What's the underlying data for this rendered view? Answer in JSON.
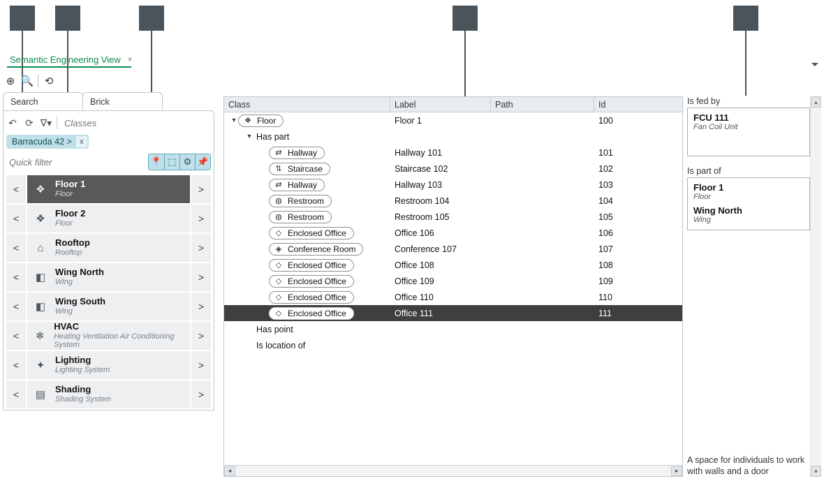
{
  "tab": {
    "title": "Semantic Engineering View"
  },
  "left_tabs": {
    "search": "Search",
    "brick": "Brick"
  },
  "classes_placeholder": "Classes",
  "chip": "Barracuda 42 >",
  "quick_filter_placeholder": "Quick filter",
  "nav": [
    {
      "title": "Floor 1",
      "sub": "Floor",
      "icon": "floor-icon",
      "sel": true
    },
    {
      "title": "Floor 2",
      "sub": "Floor",
      "icon": "floor-icon"
    },
    {
      "title": "Rooftop",
      "sub": "Rooftop",
      "icon": "rooftop-icon"
    },
    {
      "title": "Wing North",
      "sub": "Wing",
      "icon": "wing-icon"
    },
    {
      "title": "Wing South",
      "sub": "Wing",
      "icon": "wing-icon"
    },
    {
      "title": "HVAC",
      "sub": "Heating Ventilation Air Conditioning System",
      "icon": "hvac-icon"
    },
    {
      "title": "Lighting",
      "sub": "Lighting System",
      "icon": "lighting-icon"
    },
    {
      "title": "Shading",
      "sub": "Shading System",
      "icon": "shading-icon"
    }
  ],
  "columns": {
    "class": "Class",
    "label": "Label",
    "path": "Path",
    "id": "Id"
  },
  "rows": [
    {
      "indent": 0,
      "expander": "▾",
      "pill": true,
      "picon": "floor-icon",
      "pclass": "Floor",
      "label": "Floor 1",
      "id": "100"
    },
    {
      "indent": 1,
      "expander": "▾",
      "pill": false,
      "pclass": "Has part"
    },
    {
      "indent": 2,
      "pill": true,
      "picon": "hallway-icon",
      "pclass": "Hallway",
      "label": "Hallway 101",
      "id": "101"
    },
    {
      "indent": 2,
      "pill": true,
      "picon": "staircase-icon",
      "pclass": "Staircase",
      "label": "Staircase 102",
      "id": "102"
    },
    {
      "indent": 2,
      "pill": true,
      "picon": "hallway-icon",
      "pclass": "Hallway",
      "label": "Hallway 103",
      "id": "103"
    },
    {
      "indent": 2,
      "pill": true,
      "picon": "restroom-icon",
      "pclass": "Restroom",
      "label": "Restroom 104",
      "id": "104"
    },
    {
      "indent": 2,
      "pill": true,
      "picon": "restroom-icon",
      "pclass": "Restroom",
      "label": "Restroom 105",
      "id": "105"
    },
    {
      "indent": 2,
      "pill": true,
      "picon": "office-icon",
      "pclass": "Enclosed Office",
      "label": "Office 106",
      "id": "106"
    },
    {
      "indent": 2,
      "pill": true,
      "picon": "conference-icon",
      "pclass": "Conference Room",
      "label": "Conference 107",
      "id": "107"
    },
    {
      "indent": 2,
      "pill": true,
      "picon": "office-icon",
      "pclass": "Enclosed Office",
      "label": "Office 108",
      "id": "108"
    },
    {
      "indent": 2,
      "pill": true,
      "picon": "office-icon",
      "pclass": "Enclosed Office",
      "label": "Office 109",
      "id": "109"
    },
    {
      "indent": 2,
      "pill": true,
      "picon": "office-icon",
      "pclass": "Enclosed Office",
      "label": "Office 110",
      "id": "110"
    },
    {
      "indent": 2,
      "pill": true,
      "picon": "office-icon",
      "pclass": "Enclosed Office",
      "label": "Office 111",
      "id": "111",
      "sel": true
    },
    {
      "indent": 1,
      "pill": false,
      "pclass": "Has point"
    },
    {
      "indent": 1,
      "pill": false,
      "pclass": "Is location of"
    }
  ],
  "right": {
    "fed_title": "Is fed by",
    "fed": [
      {
        "n": "FCU 111",
        "s": "Fan Coil Unit"
      }
    ],
    "part_title": "Is part of",
    "part": [
      {
        "n": "Floor 1",
        "s": "Floor"
      },
      {
        "n": "Wing North",
        "s": "Wing"
      }
    ],
    "desc": "A space for individuals to work with walls and a door"
  },
  "icons": {
    "floor-icon": "❖",
    "rooftop-icon": "⌂",
    "wing-icon": "◧",
    "hvac-icon": "❄",
    "lighting-icon": "✦",
    "shading-icon": "▤",
    "hallway-icon": "⇄",
    "staircase-icon": "⇅",
    "restroom-icon": "◍",
    "office-icon": "◇",
    "conference-icon": "◈"
  }
}
